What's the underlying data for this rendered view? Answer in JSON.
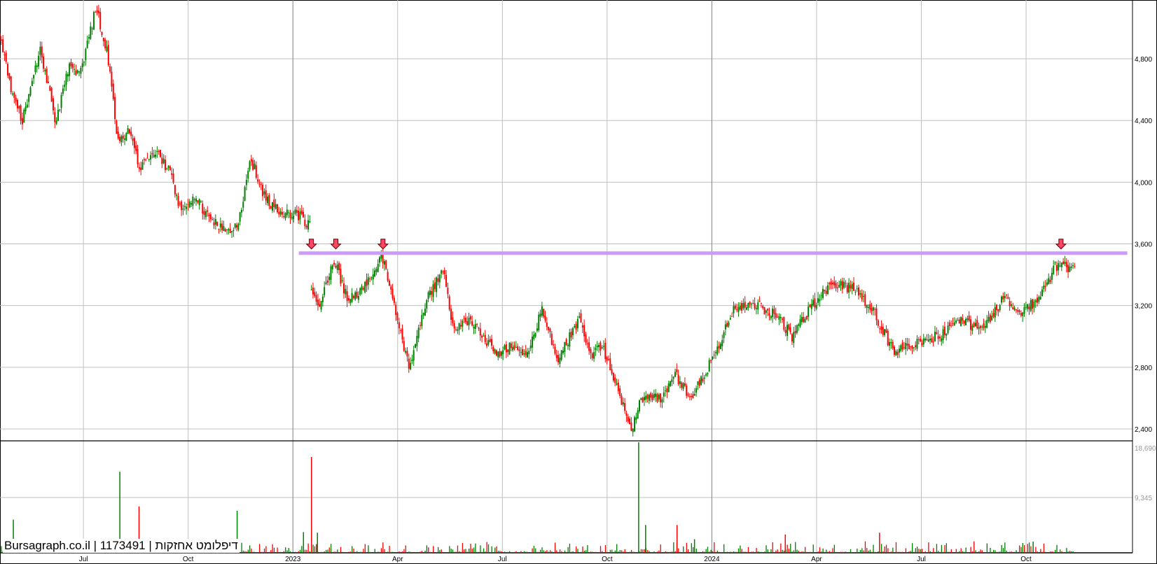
{
  "watermark": "Bursagraph.co.il | 1173491 | דיפלומט אחזקות",
  "chart_data": {
    "type": "candlestick",
    "title": "",
    "x_unit": "months since Jan 2022",
    "x_range": [
      3.6,
      34.4
    ],
    "price_axis": {
      "ticks": [
        "2,400",
        "2,800",
        "3,200",
        "3,600",
        "4,000",
        "4,400",
        "4,800"
      ],
      "tick_values": [
        2400,
        2800,
        3200,
        3600,
        4000,
        4400,
        4800
      ],
      "ylim": [
        2330,
        5150
      ]
    },
    "volume_axis": {
      "ticks": [
        "18,690",
        "9,345"
      ],
      "tick_values": [
        18690,
        9345
      ],
      "ylim": [
        0,
        18690
      ]
    },
    "x_ticks": [
      {
        "m": 6,
        "label": "Jul"
      },
      {
        "m": 9,
        "label": "Oct"
      },
      {
        "m": 12,
        "label": "2023",
        "major": true
      },
      {
        "m": 15,
        "label": "Apr"
      },
      {
        "m": 18,
        "label": "Jul"
      },
      {
        "m": 21,
        "label": "Oct"
      },
      {
        "m": 24,
        "label": "2024",
        "major": true
      },
      {
        "m": 27,
        "label": "Apr"
      },
      {
        "m": 30,
        "label": "Jul"
      },
      {
        "m": 33,
        "label": "Oct"
      }
    ],
    "price_path": [
      [
        3.6,
        4950
      ],
      [
        3.93,
        4600
      ],
      [
        4.25,
        4400
      ],
      [
        4.77,
        4850
      ],
      [
        5.2,
        4400
      ],
      [
        5.6,
        4750
      ],
      [
        5.9,
        4700
      ],
      [
        6.36,
        5130
      ],
      [
        6.68,
        4850
      ],
      [
        7.0,
        4250
      ],
      [
        7.3,
        4350
      ],
      [
        7.6,
        4100
      ],
      [
        8.05,
        4200
      ],
      [
        8.5,
        4050
      ],
      [
        8.8,
        3800
      ],
      [
        9.2,
        3900
      ],
      [
        9.5,
        3800
      ],
      [
        9.95,
        3700
      ],
      [
        10.4,
        3700
      ],
      [
        10.8,
        4150
      ],
      [
        11.2,
        3900
      ],
      [
        11.6,
        3800
      ],
      [
        12.07,
        3800
      ],
      [
        12.5,
        3720
      ],
      [
        12.53,
        3300
      ],
      [
        12.77,
        3200
      ],
      [
        13.17,
        3500
      ],
      [
        13.55,
        3250
      ],
      [
        13.97,
        3300
      ],
      [
        14.56,
        3520
      ],
      [
        15.0,
        3100
      ],
      [
        15.34,
        2780
      ],
      [
        15.77,
        3200
      ],
      [
        16.3,
        3450
      ],
      [
        16.6,
        3050
      ],
      [
        17.14,
        3100
      ],
      [
        17.56,
        2950
      ],
      [
        17.9,
        2900
      ],
      [
        18.3,
        2950
      ],
      [
        18.66,
        2850
      ],
      [
        19.15,
        3180
      ],
      [
        19.57,
        2850
      ],
      [
        20.2,
        3100
      ],
      [
        20.5,
        2870
      ],
      [
        20.84,
        2950
      ],
      [
        21.16,
        2750
      ],
      [
        21.7,
        2400
      ],
      [
        22.0,
        2600
      ],
      [
        22.53,
        2600
      ],
      [
        22.95,
        2750
      ],
      [
        23.4,
        2600
      ],
      [
        23.9,
        2800
      ],
      [
        24.2,
        2950
      ],
      [
        24.65,
        3180
      ],
      [
        25.3,
        3200
      ],
      [
        25.8,
        3150
      ],
      [
        26.3,
        3000
      ],
      [
        26.87,
        3200
      ],
      [
        27.5,
        3350
      ],
      [
        28.1,
        3300
      ],
      [
        28.66,
        3150
      ],
      [
        29.2,
        2900
      ],
      [
        29.7,
        2950
      ],
      [
        30.46,
        3000
      ],
      [
        31.1,
        3100
      ],
      [
        31.8,
        3050
      ],
      [
        32.36,
        3250
      ],
      [
        32.8,
        3150
      ],
      [
        33.4,
        3250
      ],
      [
        33.84,
        3450
      ],
      [
        34.37,
        3450
      ]
    ],
    "volume_spikes": [
      [
        3.99,
        5600,
        "up"
      ],
      [
        6.9,
        1900,
        "down"
      ],
      [
        7.04,
        13700,
        "up"
      ],
      [
        7.59,
        7850,
        "down"
      ],
      [
        10.4,
        7100,
        "up"
      ],
      [
        12.53,
        16200,
        "down"
      ],
      [
        12.7,
        3400,
        "up"
      ],
      [
        21.9,
        18690,
        "up"
      ],
      [
        22.1,
        4700,
        "up"
      ],
      [
        23.0,
        4700,
        "down"
      ],
      [
        26.1,
        3100,
        "down"
      ],
      [
        28.8,
        3400,
        "down"
      ],
      [
        33.2,
        1900,
        "up"
      ],
      [
        23.5,
        2300,
        "up"
      ],
      [
        12.3,
        3500,
        "up"
      ]
    ],
    "colors": {
      "up": "#008000",
      "down": "#ff0000",
      "resistance": "#cc99ff",
      "marker": "#ff4466"
    },
    "resistance_line": {
      "price": 3540,
      "from_m": 12.17,
      "to_m": 35.9
    },
    "markers": [
      {
        "m": 12.53,
        "type": "down-arrow"
      },
      {
        "m": 13.23,
        "type": "down-arrow"
      },
      {
        "m": 14.58,
        "type": "down-arrow"
      },
      {
        "m": 34.0,
        "type": "down-arrow"
      }
    ]
  }
}
